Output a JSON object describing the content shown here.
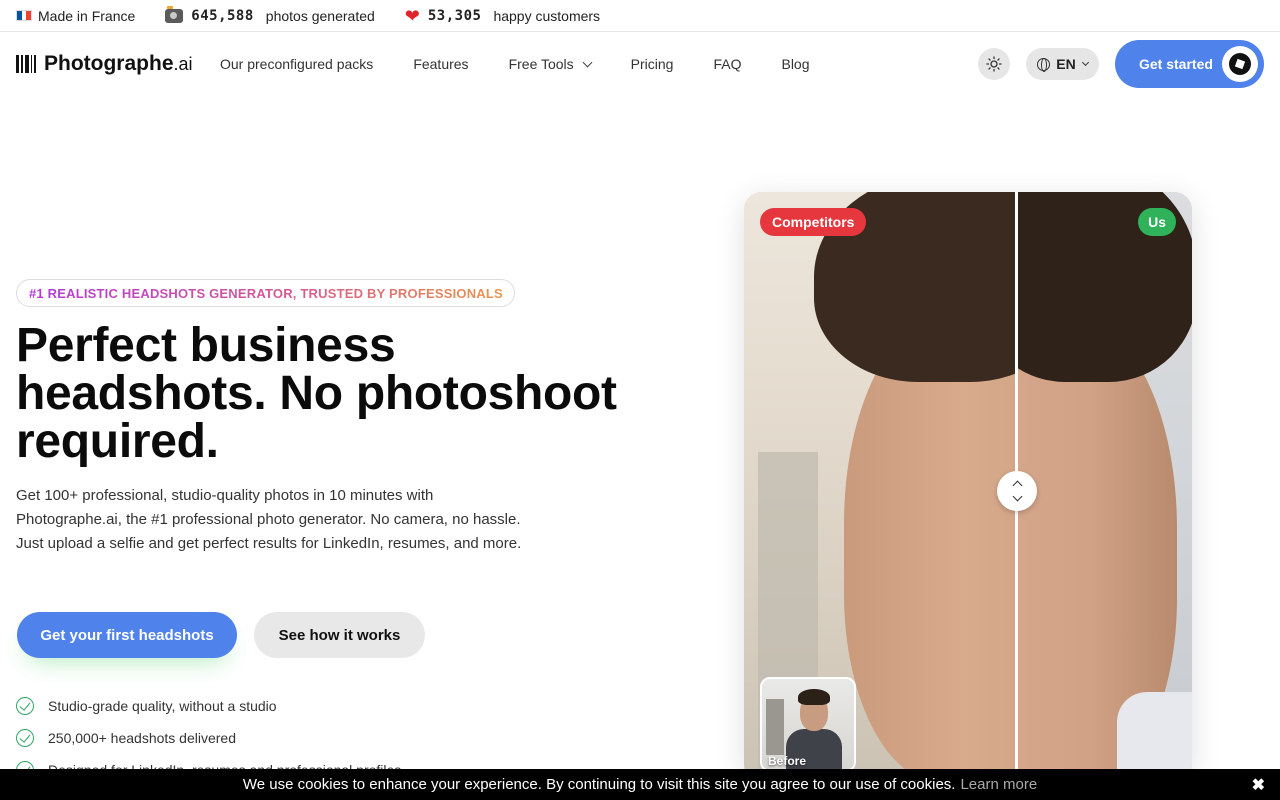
{
  "topbar": {
    "made_in": "Made in France",
    "photos_count": "645,588",
    "photos_label": "photos generated",
    "customers_count": "53,305",
    "customers_label": "happy customers",
    "flag_colors": [
      "#0055a4",
      "#ffffff",
      "#ef4135"
    ],
    "photos_icon": "camera-icon",
    "customers_icon": "heart-icon"
  },
  "header": {
    "logo_main": "Photographe",
    "logo_suffix": ".ai",
    "nav": [
      {
        "label": "Our preconfigured packs"
      },
      {
        "label": "Features"
      },
      {
        "label": "Free Tools",
        "dropdown": true
      },
      {
        "label": "Pricing"
      },
      {
        "label": "FAQ"
      },
      {
        "label": "Blog"
      }
    ],
    "language": "EN",
    "cta": "Get started"
  },
  "hero": {
    "badge": "#1 REALISTIC HEADSHOTS GENERATOR, TRUSTED BY PROFESSIONALS",
    "title_line1": "Perfect business",
    "title_line2": "headshots. No photoshoot",
    "title_line3": "required.",
    "description": "Get 100+ professional, studio-quality photos in 10 minutes with Photographe.ai, the #1 professional photo generator. No camera, no hassle. Just upload a selfie and get perfect results for LinkedIn, resumes, and more.",
    "primary_button": "Get your first headshots",
    "secondary_button": "See how it works",
    "features": [
      "Studio-grade quality, without a studio",
      "250,000+ headshots delivered",
      "Designed for LinkedIn, resumes and professional profiles"
    ]
  },
  "comparison": {
    "left_label": "Competitors",
    "right_label": "Us",
    "thumb_label": "Before",
    "colors": {
      "left_label_bg": "#e5373d",
      "right_label_bg": "#2fb25a"
    }
  },
  "cookie": {
    "text": "We use cookies to enhance your experience. By continuing to visit this site you agree to our use of cookies.",
    "link": "Learn more",
    "close": "✖"
  },
  "colors": {
    "accent": "#4f82ea",
    "check": "#2fa865"
  }
}
